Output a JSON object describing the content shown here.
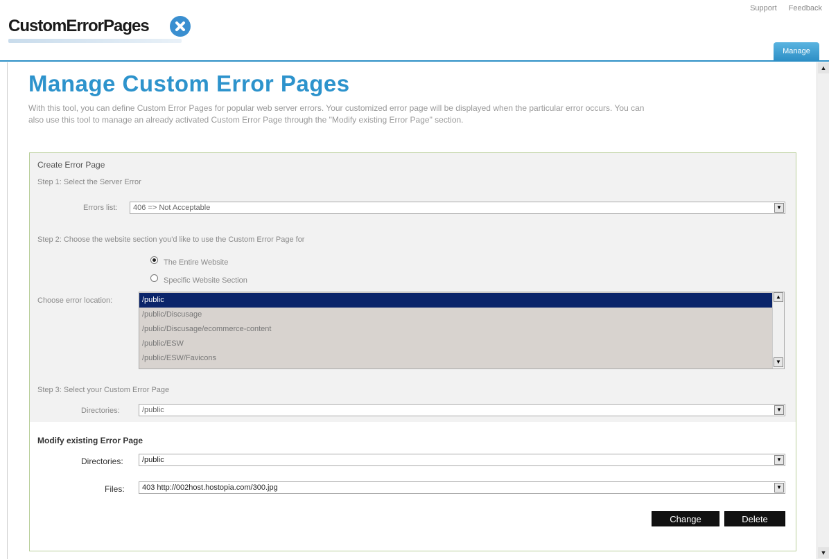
{
  "header": {
    "logo_text": "CustomErrorPages",
    "links": [
      "Support",
      "Feedback"
    ],
    "manage_tab": "Manage"
  },
  "page": {
    "title": "Manage Custom Error Pages",
    "intro_line1": "With this tool, you can define Custom Error Pages for popular web server errors. Your customized error page will be displayed when the particular error occurs. You can",
    "intro_line2": "also use this tool to manage an already activated Custom Error Page through the \"Modify existing Error Page\" section."
  },
  "create": {
    "title": "Create Error Page",
    "step1": "Step 1: Select the Server Error",
    "errors_label": "Errors list:",
    "errors_value": "406 => Not Acceptable",
    "step2": "Step 2: Choose the website section you'd like to use the Custom Error Page for",
    "radio_entire": "The Entire Website",
    "radio_specific": "Specific Website Section",
    "location_label": "Choose error location:",
    "locations": [
      "/public",
      "/public/Discusage",
      "/public/Discusage/ecommerce-content",
      "/public/ESW",
      "/public/ESW/Favicons"
    ],
    "step3": "Step 3: Select your Custom Error Page",
    "directories_label": "Directories:",
    "directories_value": "/public"
  },
  "modify": {
    "title": "Modify existing Error Page",
    "directories_label": "Directories:",
    "directories_value": "/public",
    "files_label": "Files:",
    "files_value": "403 http://002host.hostopia.com/300.jpg",
    "change_label": "Change",
    "delete_label": "Delete"
  },
  "colors": {
    "accent": "#2d93cc",
    "selected": "#0a246a",
    "panel_border": "#b9cf9b"
  }
}
